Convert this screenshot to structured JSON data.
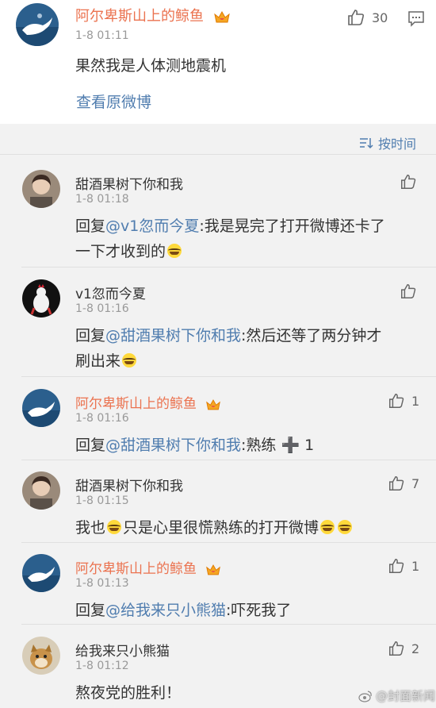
{
  "main_post": {
    "username": "阿尔卑斯山上的鲸鱼",
    "time": "1-8 01:11",
    "text": "果然我是人体测地震机",
    "link": "查看原微博",
    "likes": "30"
  },
  "sort": {
    "label": "按时间"
  },
  "comments": [
    {
      "username": "甜酒果树下你和我",
      "time": "1-8 01:18",
      "prefix": "回复",
      "mention": "@v1忽而今夏",
      "text": ":我是晃完了打开微博还卡了",
      "text2": "一下才收到的",
      "likes": ""
    },
    {
      "username": "v1忽而今夏",
      "time": "1-8 01:16",
      "prefix": "回复",
      "mention": "@甜酒果树下你和我",
      "text": ":然后还等了两分钟才",
      "text2": "刷出来",
      "likes": ""
    },
    {
      "username": "阿尔卑斯山上的鲸鱼",
      "time": "1-8 01:16",
      "prefix": "回复",
      "mention": "@甜酒果树下你和我",
      "text": ":熟练 ➕ 1",
      "likes": "1"
    },
    {
      "username": "甜酒果树下你和我",
      "time": "1-8 01:15",
      "text_a": "我也",
      "text_b": "只是心里很慌熟练的打开微博",
      "likes": "7"
    },
    {
      "username": "阿尔卑斯山上的鲸鱼",
      "time": "1-8 01:13",
      "prefix": "回复",
      "mention": "@给我来只小熊猫",
      "text": ":吓死我了",
      "likes": "1"
    },
    {
      "username": "给我来只小熊猫",
      "time": "1-8 01:12",
      "text": "熬夜党的胜利！",
      "likes": "2"
    }
  ],
  "watermark": "@封面新闻",
  "colors": {
    "orange_name": "#eb7350",
    "link_blue": "#507daf"
  }
}
